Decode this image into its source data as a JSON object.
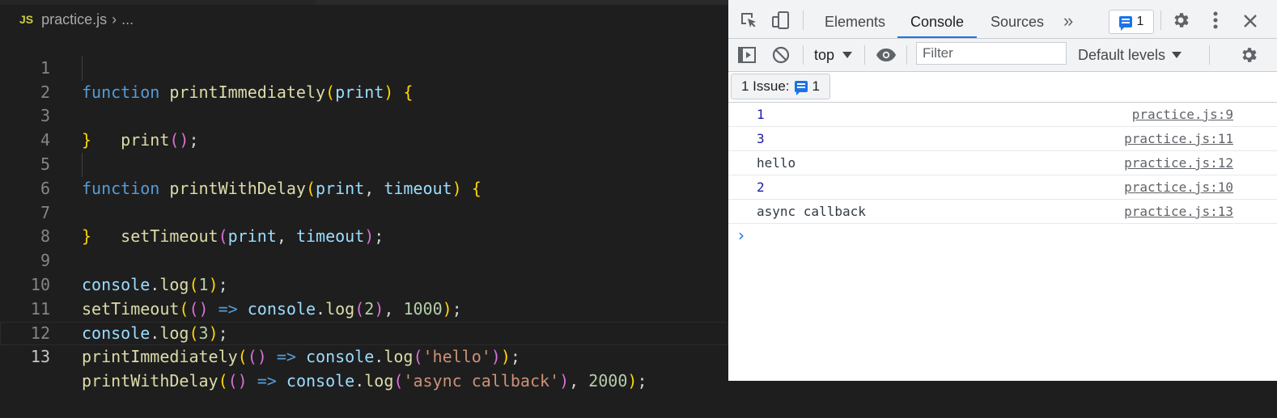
{
  "editor": {
    "file_badge": "JS",
    "breadcrumb": {
      "file": "practice.js",
      "separator": "›",
      "more": "..."
    },
    "lines": [
      {
        "n": "1"
      },
      {
        "n": "2"
      },
      {
        "n": "3"
      },
      {
        "n": "4"
      },
      {
        "n": "5"
      },
      {
        "n": "6"
      },
      {
        "n": "7"
      },
      {
        "n": "8"
      },
      {
        "n": "9"
      },
      {
        "n": "10"
      },
      {
        "n": "11"
      },
      {
        "n": "12"
      },
      {
        "n": "13"
      }
    ],
    "code": {
      "kw_function": "function",
      "fn_printImmediately": "printImmediately",
      "fn_printWithDelay": "printWithDelay",
      "pm_print": "print",
      "pm_timeout": "timeout",
      "fn_setTimeout": "setTimeout",
      "pm_console": "console",
      "fn_log": "log",
      "arrow": "=>",
      "n1": "1",
      "n2": "2",
      "n3": "3",
      "n1000": "1000",
      "n2000": "2000",
      "s_hello": "'hello'",
      "s_async": "'async callback'"
    },
    "colors": {
      "keyword": "#569cd6",
      "function": "#dcdcaa",
      "param": "#9cdcfe",
      "number": "#b5cea8",
      "string": "#ce9178"
    }
  },
  "devtools": {
    "tabs": [
      {
        "label": "Elements"
      },
      {
        "label": "Console"
      },
      {
        "label": "Sources"
      }
    ],
    "more_tabs": "»",
    "issues_count": "1",
    "toolbar": {
      "context": "top",
      "filter_placeholder": "Filter",
      "levels": "Default levels"
    },
    "issues_bar": {
      "label": "1 Issue:",
      "count": "1"
    },
    "console": {
      "rows": [
        {
          "message": "1",
          "source": "practice.js:9"
        },
        {
          "message": "3",
          "source": "practice.js:11"
        },
        {
          "message": "hello",
          "source": "practice.js:12"
        },
        {
          "message": "2",
          "source": "practice.js:10"
        },
        {
          "message": "async callback",
          "source": "practice.js:13"
        }
      ],
      "prompt": "›"
    },
    "accent": "#1a73e8"
  }
}
